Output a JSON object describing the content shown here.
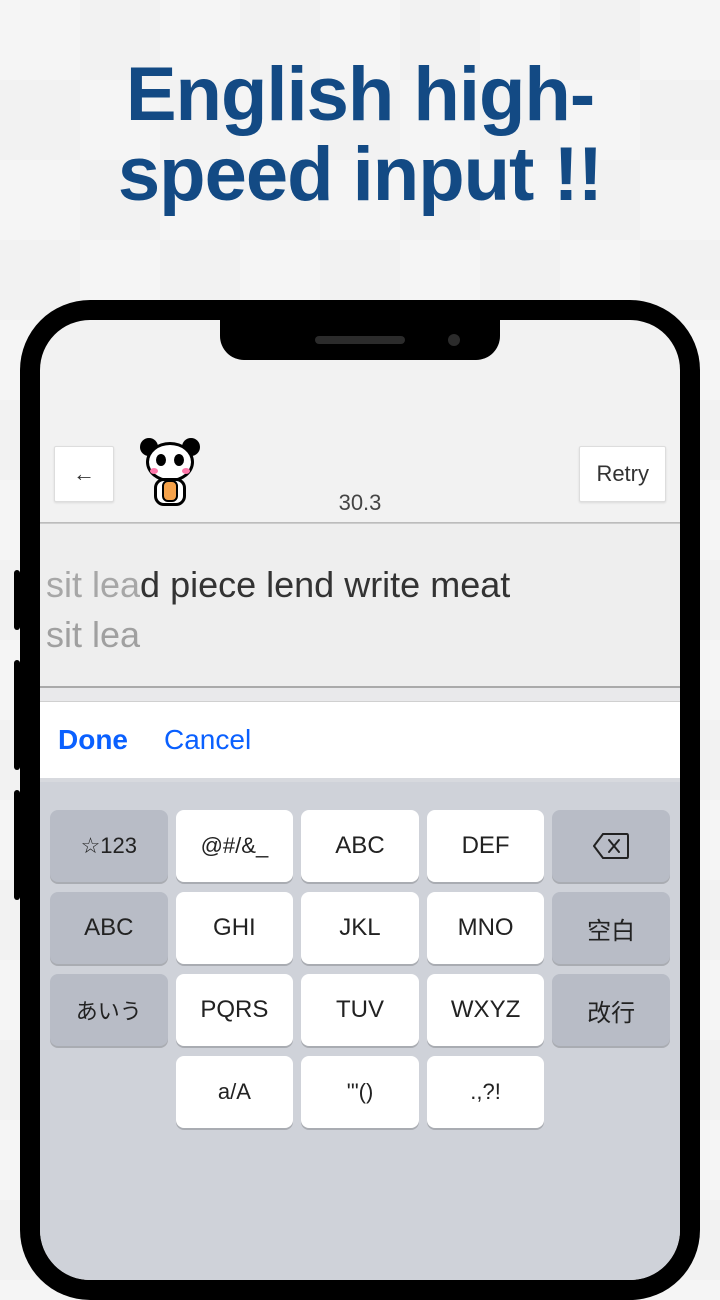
{
  "hero": {
    "title": "English high-speed input !!"
  },
  "toolbar": {
    "back_label": "←",
    "retry_label": "Retry",
    "timer": "30.3"
  },
  "typing": {
    "target_typed": "sit lea",
    "target_rest": "d piece lend write meat",
    "entered": "sit lea"
  },
  "actions": {
    "done": "Done",
    "cancel": "Cancel"
  },
  "keyboard": {
    "rows": [
      [
        "☆123",
        "@#/&_",
        "ABC",
        "DEF",
        "⌫"
      ],
      [
        "ABC",
        "GHI",
        "JKL",
        "MNO",
        "空白"
      ],
      [
        "あいう",
        "PQRS",
        "TUV",
        "WXYZ",
        "改行"
      ],
      [
        "",
        "a/A",
        "'\"()",
        ".,?!",
        ""
      ]
    ],
    "r1": {
      "k0": "☆123",
      "k1": "@#/&_",
      "k2": "ABC",
      "k3": "DEF"
    },
    "r2": {
      "k0": "ABC",
      "k1": "GHI",
      "k2": "JKL",
      "k3": "MNO",
      "k4": "空白"
    },
    "r3": {
      "k0": "あいう",
      "k1": "PQRS",
      "k2": "TUV",
      "k3": "WXYZ",
      "k4": "改行"
    },
    "r4": {
      "k1": "a/A",
      "k2": "'\"()",
      "k3": ".,?!"
    }
  }
}
